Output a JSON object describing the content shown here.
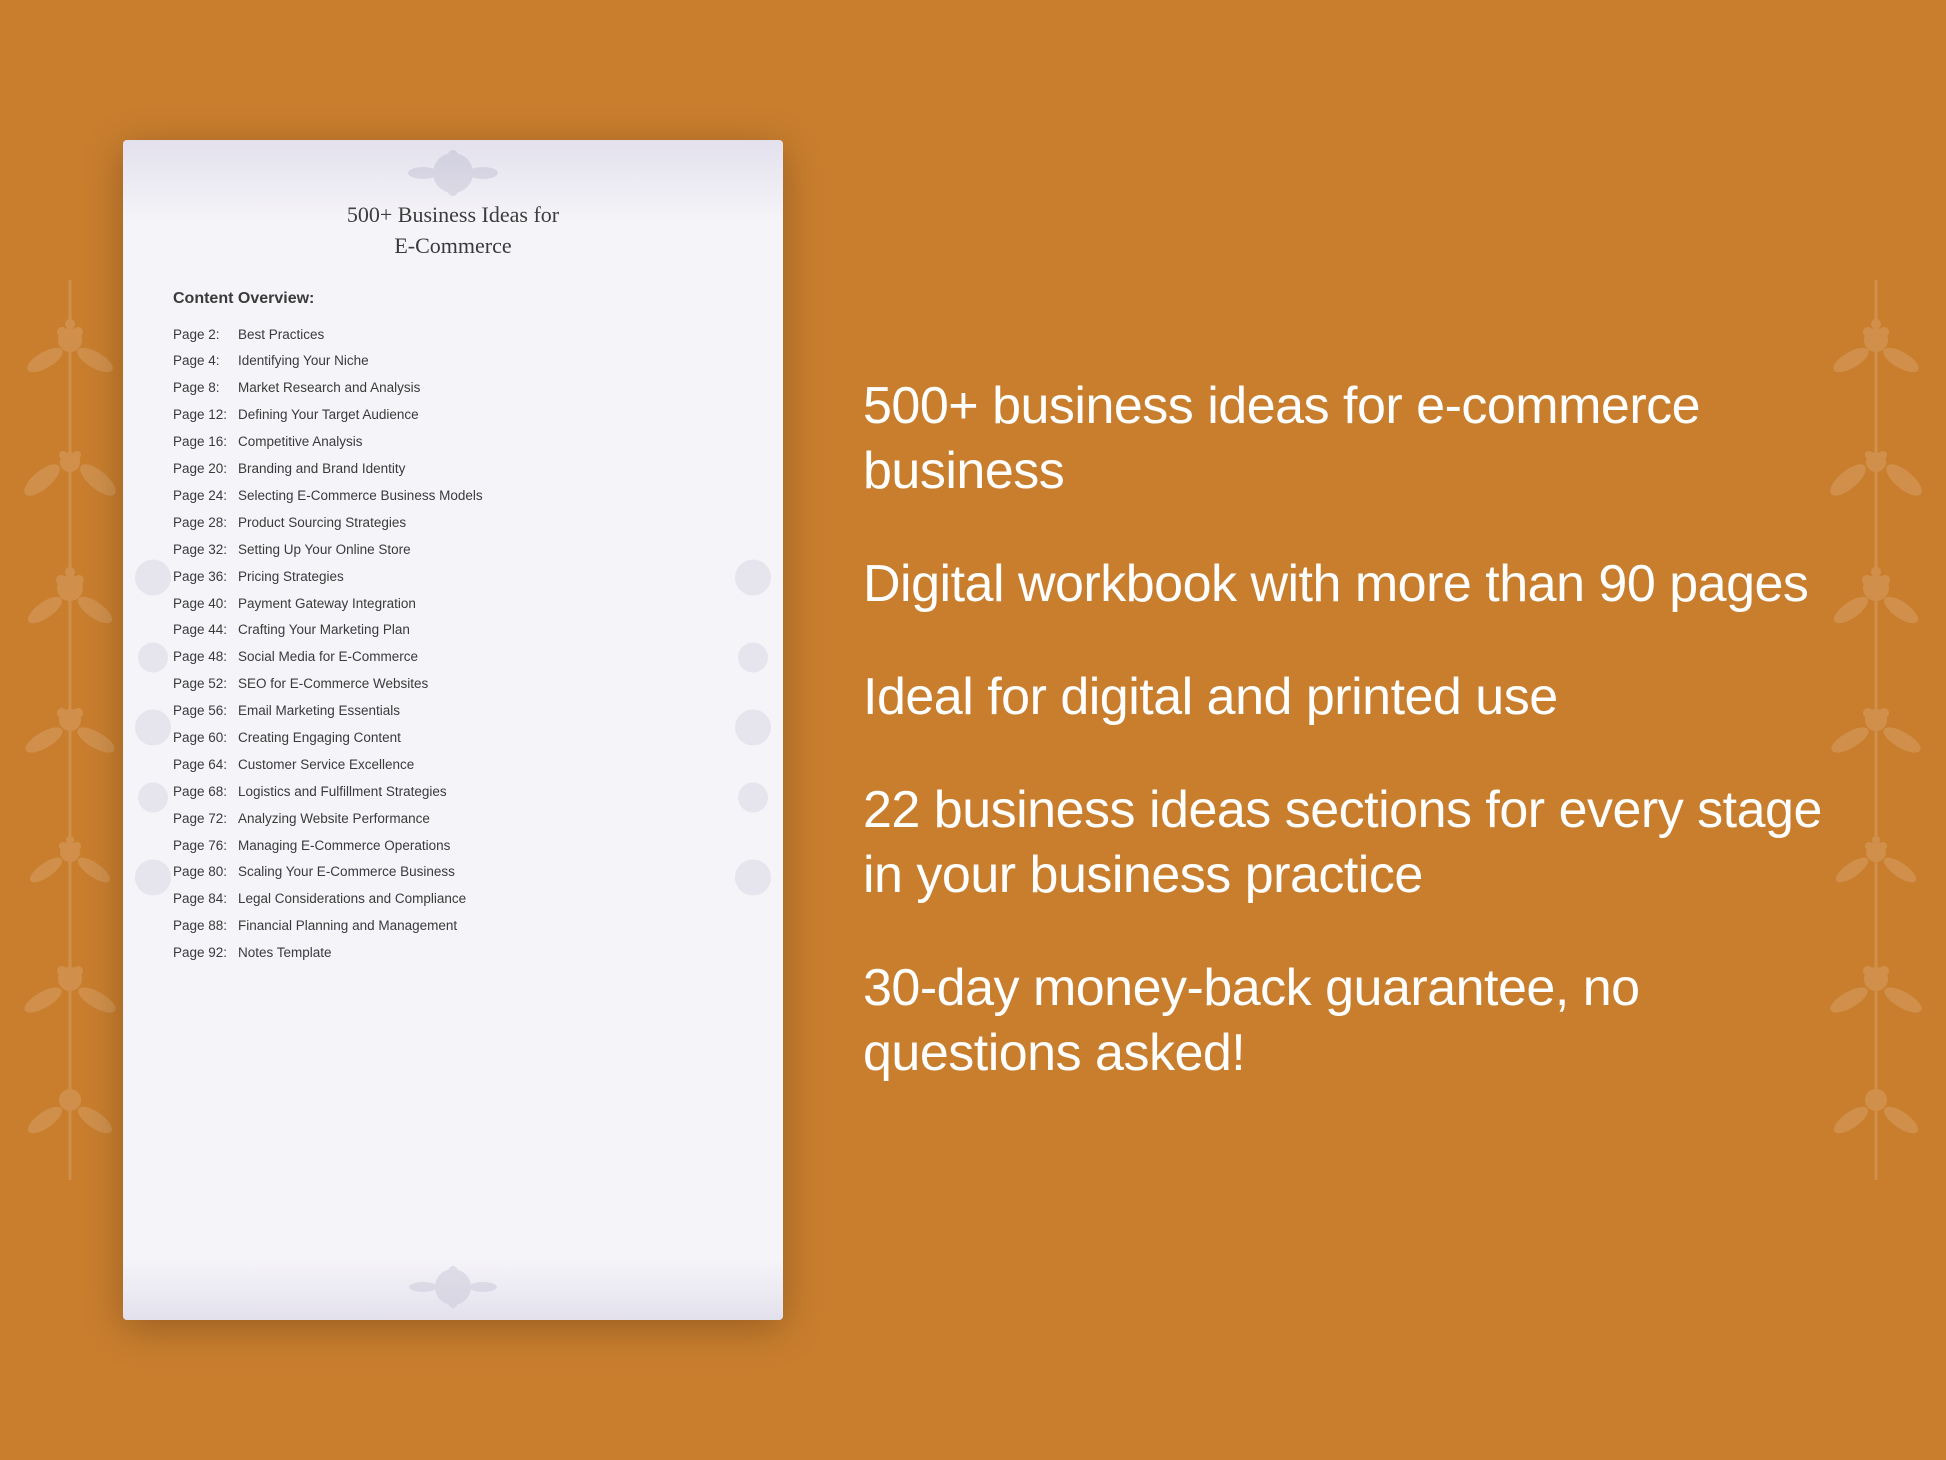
{
  "background_color": "#C97E2E",
  "document": {
    "title_line1": "500+ Business Ideas for",
    "title_line2": "E-Commerce",
    "section_header": "Content Overview:",
    "toc_items": [
      {
        "page": "Page  2:",
        "topic": "Best Practices"
      },
      {
        "page": "Page  4:",
        "topic": "Identifying Your Niche"
      },
      {
        "page": "Page  8:",
        "topic": "Market Research and Analysis"
      },
      {
        "page": "Page 12:",
        "topic": "Defining Your Target Audience"
      },
      {
        "page": "Page 16:",
        "topic": "Competitive Analysis"
      },
      {
        "page": "Page 20:",
        "topic": "Branding and Brand Identity"
      },
      {
        "page": "Page 24:",
        "topic": "Selecting E-Commerce Business Models"
      },
      {
        "page": "Page 28:",
        "topic": "Product Sourcing Strategies"
      },
      {
        "page": "Page 32:",
        "topic": "Setting Up Your Online Store"
      },
      {
        "page": "Page 36:",
        "topic": "Pricing Strategies"
      },
      {
        "page": "Page 40:",
        "topic": "Payment Gateway Integration"
      },
      {
        "page": "Page 44:",
        "topic": "Crafting Your Marketing Plan"
      },
      {
        "page": "Page 48:",
        "topic": "Social Media for E-Commerce"
      },
      {
        "page": "Page 52:",
        "topic": "SEO for E-Commerce Websites"
      },
      {
        "page": "Page 56:",
        "topic": "Email Marketing Essentials"
      },
      {
        "page": "Page 60:",
        "topic": "Creating Engaging Content"
      },
      {
        "page": "Page 64:",
        "topic": "Customer Service Excellence"
      },
      {
        "page": "Page 68:",
        "topic": "Logistics and Fulfillment Strategies"
      },
      {
        "page": "Page 72:",
        "topic": "Analyzing Website Performance"
      },
      {
        "page": "Page 76:",
        "topic": "Managing E-Commerce Operations"
      },
      {
        "page": "Page 80:",
        "topic": "Scaling Your E-Commerce Business"
      },
      {
        "page": "Page 84:",
        "topic": "Legal Considerations and Compliance"
      },
      {
        "page": "Page 88:",
        "topic": "Financial Planning and Management"
      },
      {
        "page": "Page 92:",
        "topic": "Notes Template"
      }
    ]
  },
  "features": [
    {
      "id": "feature1",
      "text": "500+ business ideas for e-commerce business"
    },
    {
      "id": "feature2",
      "text": "Digital workbook with more than 90 pages"
    },
    {
      "id": "feature3",
      "text": "Ideal for digital and printed use"
    },
    {
      "id": "feature4",
      "text": "22 business ideas sections for every stage in your business practice"
    },
    {
      "id": "feature5",
      "text": "30-day money-back guarantee, no questions asked!"
    }
  ]
}
